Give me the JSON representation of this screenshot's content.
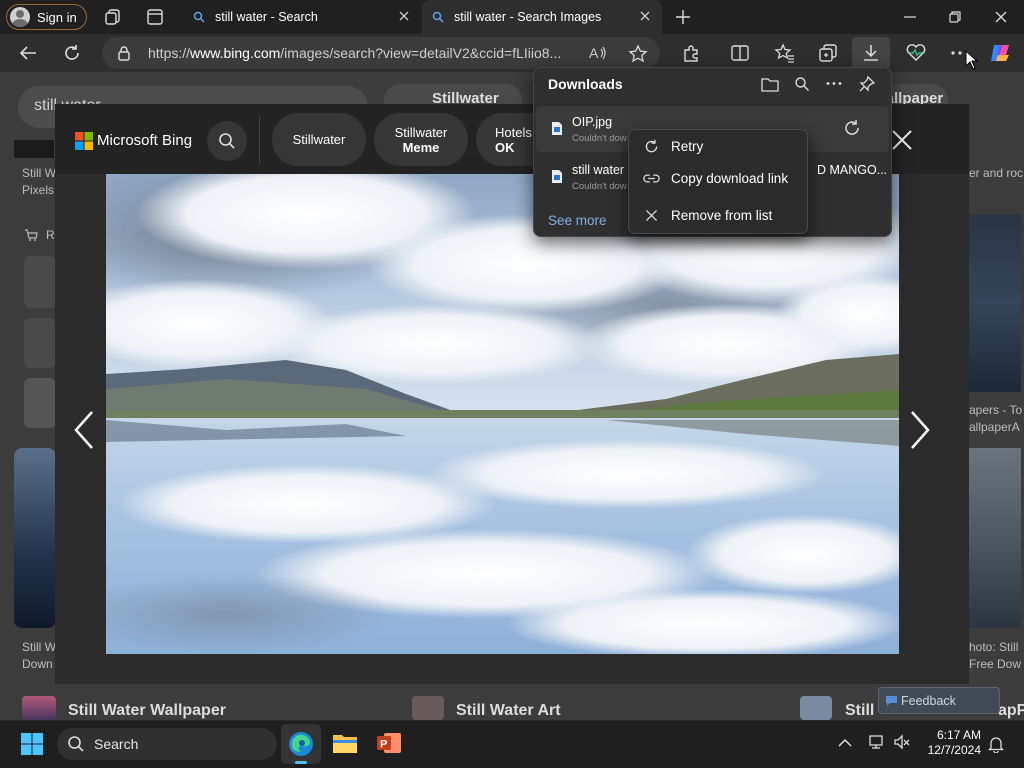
{
  "browser": {
    "sign_in": "Sign in",
    "tabs": [
      {
        "title": "still water - Search"
      },
      {
        "title": "still water - Search Images"
      }
    ],
    "url_prefix": "https://",
    "url_domain": "www.bing.com",
    "url_rest": "/images/search?view=detailV2&ccid=fLIiio8..."
  },
  "page": {
    "search_value": "still water",
    "chip_stillwater": "Stillwater",
    "chip_wallpaper": "wallpaper",
    "left_caption_1": "Still W",
    "left_caption_2": "Pixels",
    "left_caption_3": "Still W",
    "left_caption_4": "Down",
    "shop_label": "R",
    "right_caption_1": "er and roc",
    "right_caption_2": "apers - To",
    "right_caption_3": "allpaperA",
    "right_caption_4": "hoto: Still",
    "right_caption_5": "Free Dow",
    "bottom_title_1": "Still Water Wallpaper",
    "bottom_title_2": "Still Water Art",
    "bottom_title_3": "Still",
    "bottom_title_4": "apP",
    "feedback": "Feedback"
  },
  "viewer": {
    "brand": "Microsoft Bing",
    "pills": [
      {
        "line1": "Stillwater",
        "line2": ""
      },
      {
        "line1": "Stillwater",
        "line2": "Meme"
      },
      {
        "line1": "Hotels",
        "line2": "OK"
      }
    ]
  },
  "downloads": {
    "title": "Downloads",
    "items": [
      {
        "name": "OIP.jpg",
        "status": "Couldn't dow"
      },
      {
        "name": "still water I",
        "status": "Couldn't dow",
        "tail": "D MANGO..."
      }
    ],
    "see_more": "See more"
  },
  "context_menu": {
    "retry": "Retry",
    "copy_link": "Copy download link",
    "remove": "Remove from list"
  },
  "taskbar": {
    "search_label": "Search",
    "time": "6:17 AM",
    "date": "12/7/2024"
  }
}
